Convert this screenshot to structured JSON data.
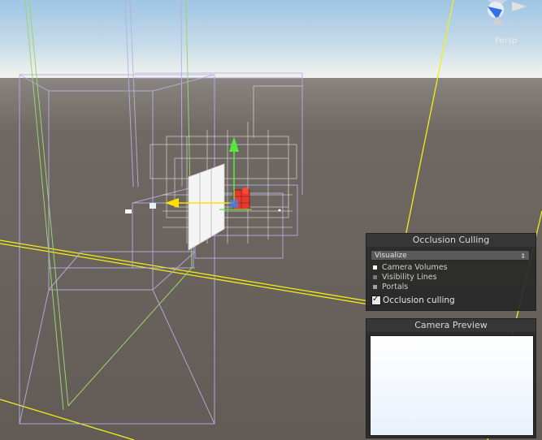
{
  "viewport": {
    "perspective_label": "Persp",
    "colors": {
      "sky": "#a9cce5",
      "horizon_glow": "#eef2f1",
      "ground": "#6a635e",
      "volume_lines": "#b5b0e2",
      "green_lines": "#9cd46a",
      "yellow_lines": "#f4ee14",
      "gizmo_y": "#57e83a",
      "gizmo_x": "#ffe000",
      "camera_object": "#e63a2c"
    }
  },
  "occlusion_panel": {
    "title": "Occlusion Culling",
    "mode_select": "Visualize",
    "legend": [
      {
        "label": "Camera Volumes",
        "color": "#ffffff"
      },
      {
        "label": "Visibility Lines",
        "color": "#7a7a7a"
      },
      {
        "label": "Portals",
        "color": "#a0a0a0"
      }
    ],
    "checkbox_label": "Occlusion culling",
    "checkbox_checked": true
  },
  "preview_panel": {
    "title": "Camera Preview"
  }
}
